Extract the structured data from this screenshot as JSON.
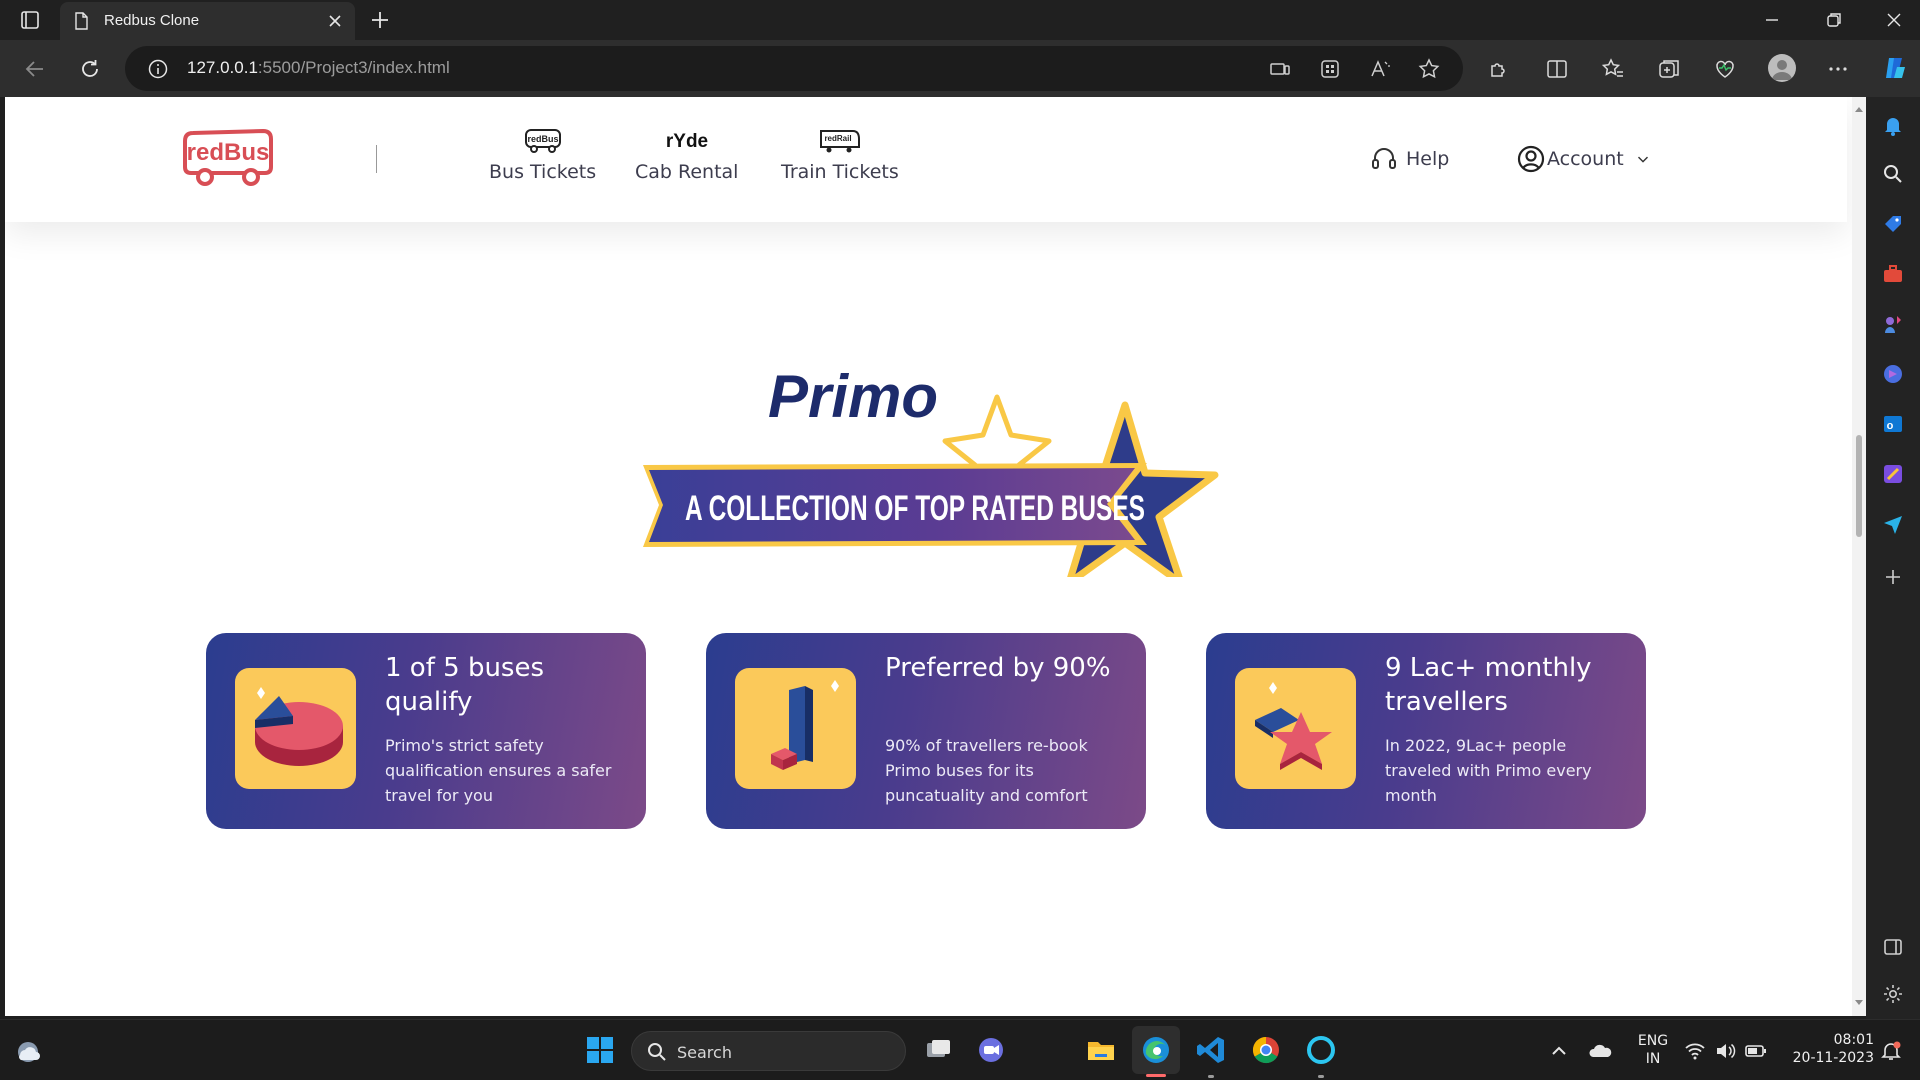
{
  "browser": {
    "tab_title": "Redbus Clone",
    "url_host": "127.0.0.1",
    "url_rest": ":5500/Project3/index.html"
  },
  "header": {
    "logo_text": "redBus",
    "nav": [
      {
        "label": "Bus Tickets",
        "icon": "redbus-bus-icon",
        "icon_text": "redBus"
      },
      {
        "label": "Cab Rental",
        "icon": "ryde-icon",
        "icon_text": "rYde"
      },
      {
        "label": "Train Tickets",
        "icon": "redrail-train-icon",
        "icon_text": "redRail"
      }
    ],
    "help_label": "Help",
    "account_label": "Account"
  },
  "primo": {
    "brand": "Primo",
    "tagline": "A COLLECTION OF TOP RATED BUSES"
  },
  "cards": [
    {
      "title": "1 of 5 buses qualify",
      "description": "Primo's strict safety qualification ensures a safer travel for you",
      "icon": "pie-chart-icon"
    },
    {
      "title": "Preferred by 90%",
      "description": "90% of travellers re-book Primo buses for its puncatuality and comfort",
      "icon": "bar-chart-icon"
    },
    {
      "title": "9 Lac+ monthly travellers",
      "description": "In 2022, 9Lac+ people traveled with Primo every month",
      "icon": "star-chart-icon"
    }
  ],
  "taskbar": {
    "search_label": "Search",
    "lang_line1": "ENG",
    "lang_line2": "IN",
    "time": "08:01",
    "date": "20-11-2023"
  },
  "colors": {
    "brand_red": "#d84e55",
    "primo_navy": "#1d2b6b",
    "primo_gold": "#f9c846",
    "card_gradient_start": "#2b3d8f",
    "card_gradient_end": "#7c4a88",
    "card_icon_bg": "#fbc95a"
  }
}
